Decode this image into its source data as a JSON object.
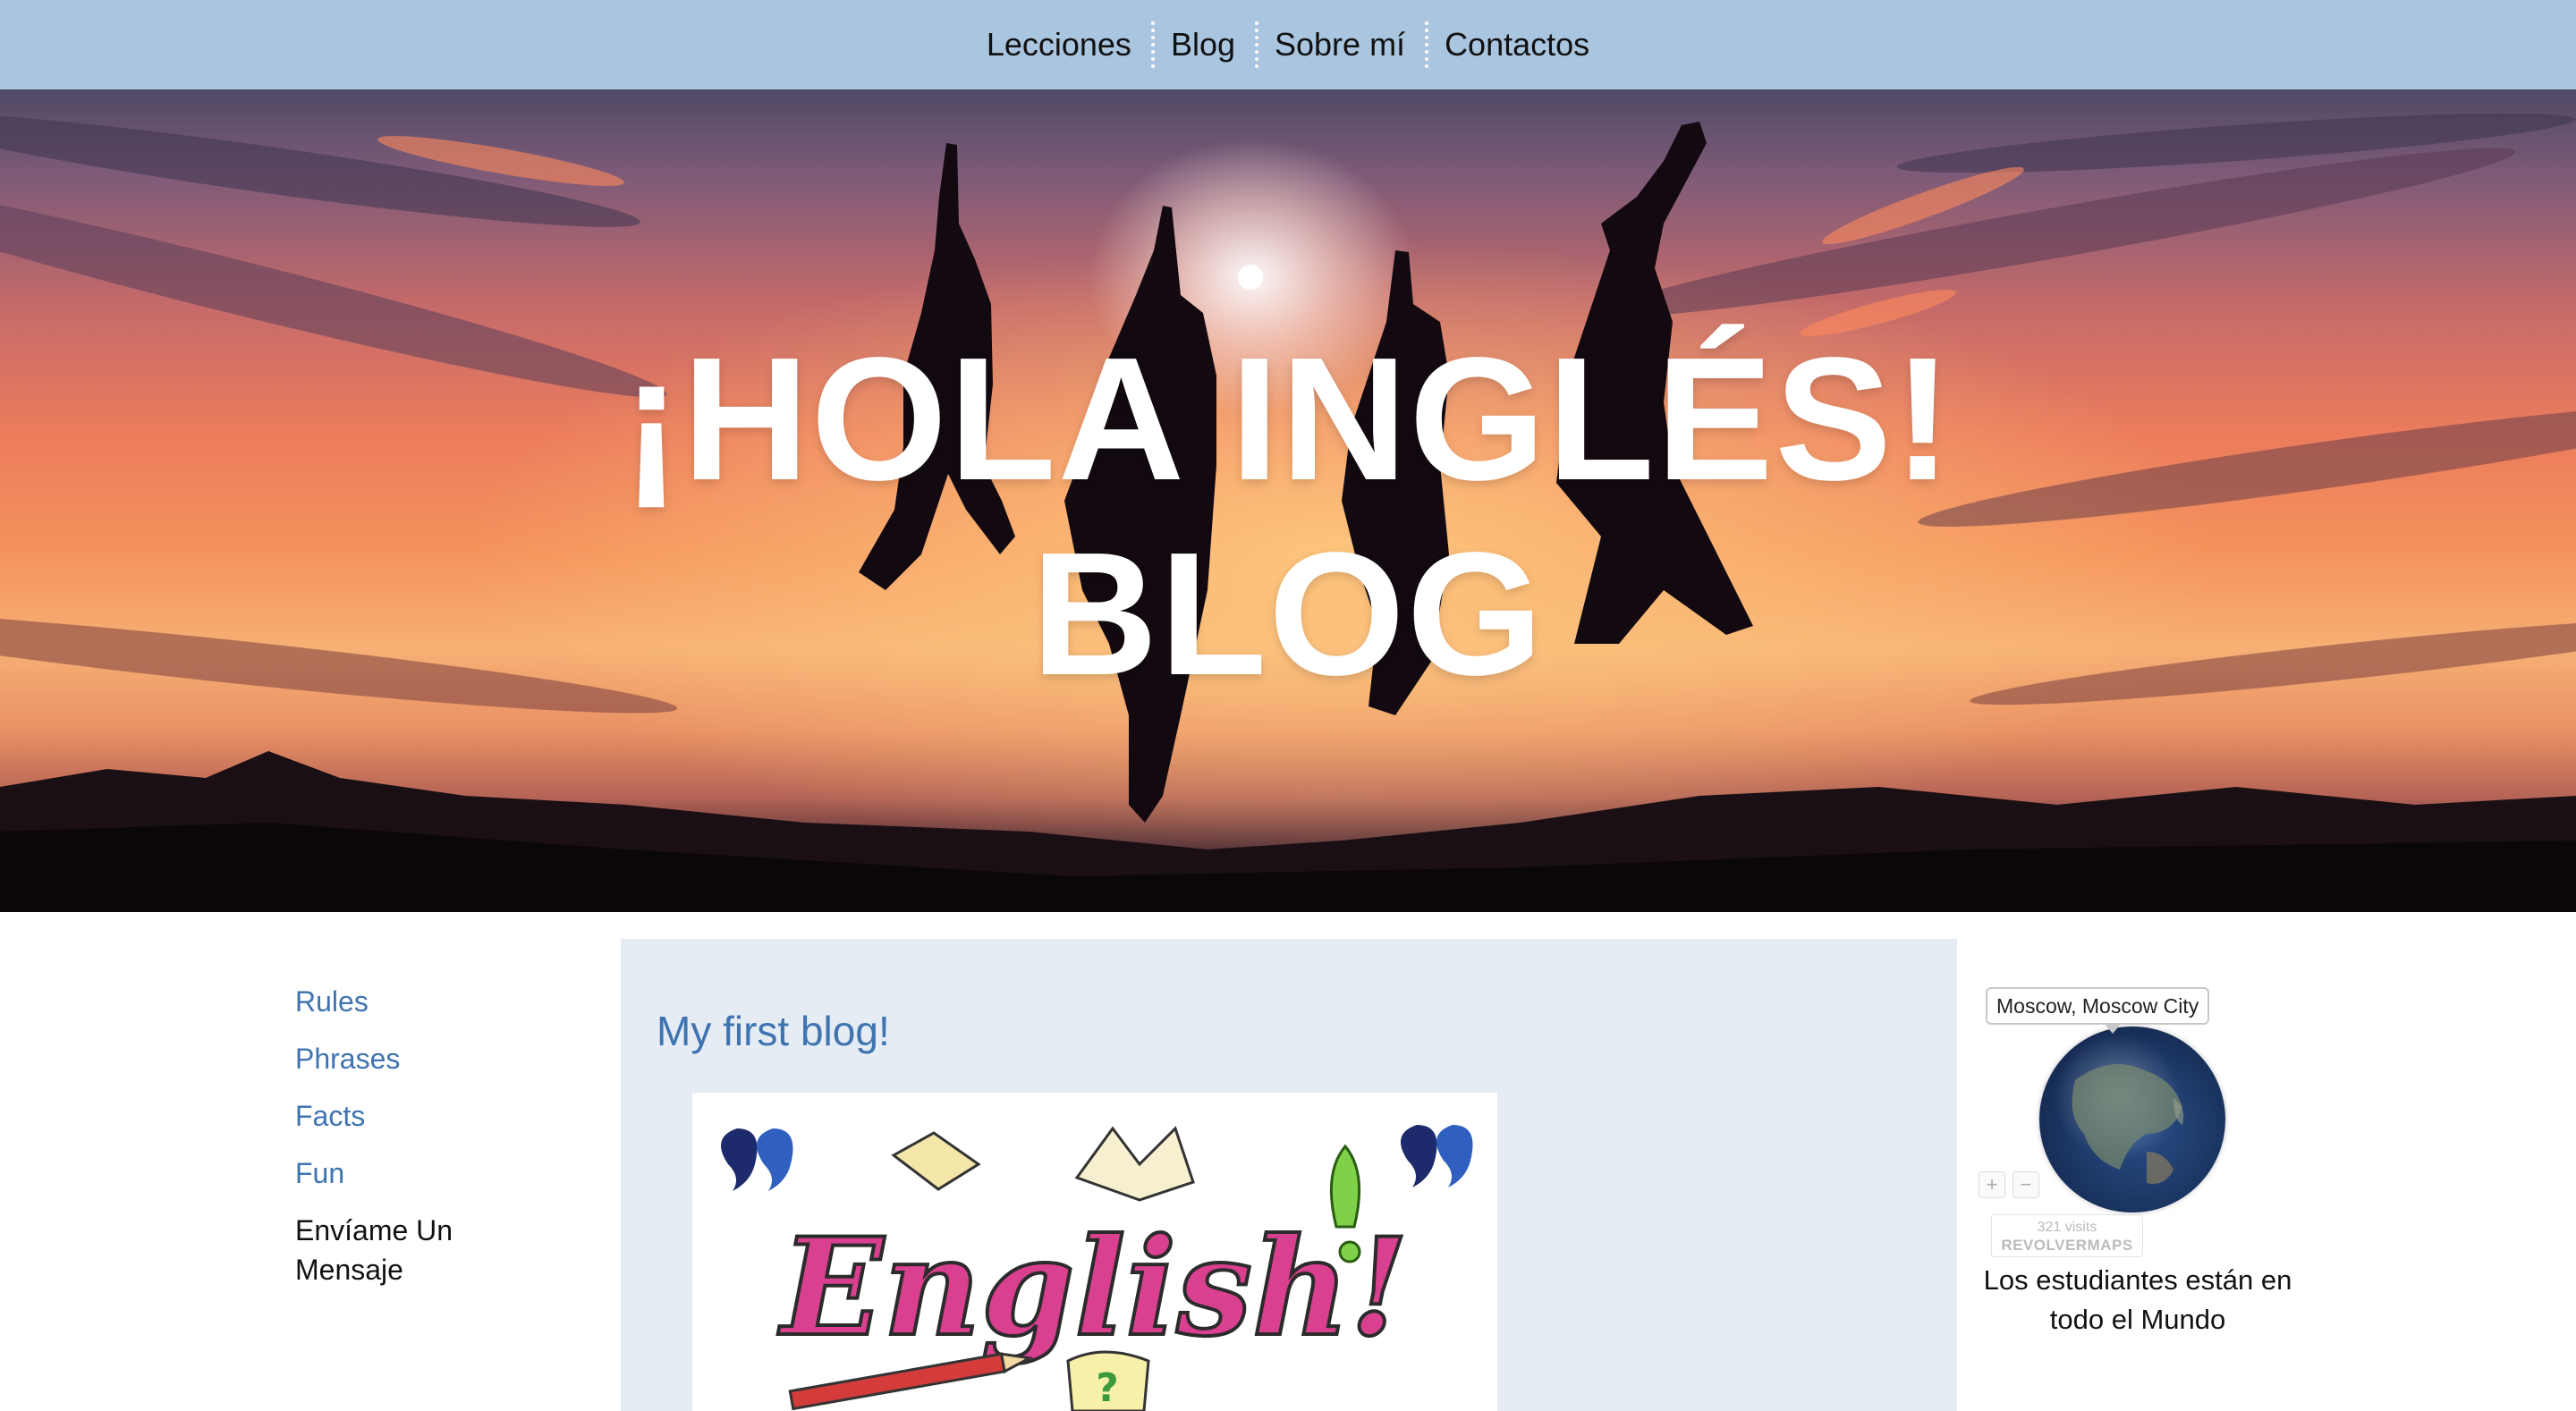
{
  "nav": {
    "items": [
      {
        "label": "Lecciones"
      },
      {
        "label": "Blog"
      },
      {
        "label": "Sobre mí"
      },
      {
        "label": "Contactos"
      }
    ]
  },
  "hero": {
    "title_line1": "¡HOLA INGLÉS!",
    "title_line2": "BLOG"
  },
  "sidebar": {
    "items": [
      {
        "label": "Rules"
      },
      {
        "label": "Phrases"
      },
      {
        "label": "Facts"
      },
      {
        "label": "Fun"
      },
      {
        "label": "Envíame Un Mensaje"
      }
    ]
  },
  "post": {
    "title": "My first blog!",
    "image_text": "English!"
  },
  "widget": {
    "tooltip": "Moscow, Moscow City",
    "zoom_in": "+",
    "zoom_out": "−",
    "visits": "321 visits",
    "brand": "REVOLVERMAPS",
    "caption": "Los estudiantes están en todo el Mundo"
  },
  "colors": {
    "nav_bg": "#a9c5df",
    "link": "#3f74b1",
    "content_bg": "#e6ecf4"
  }
}
